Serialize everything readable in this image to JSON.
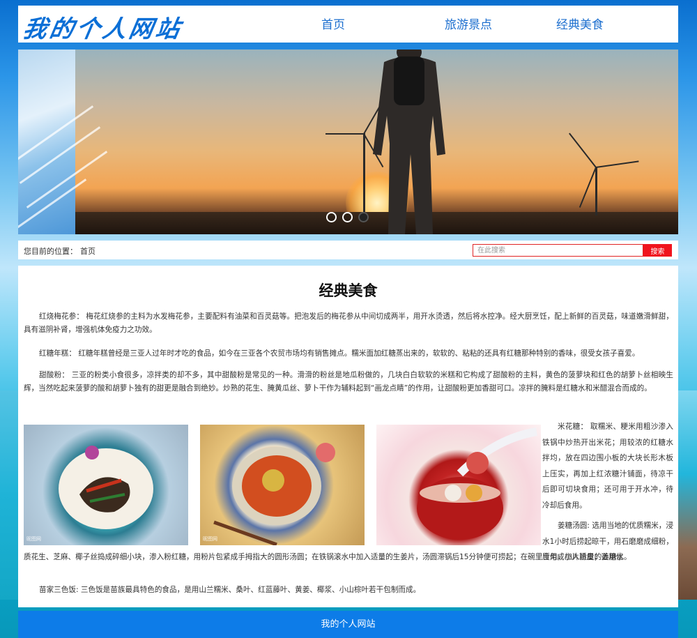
{
  "header": {
    "logo": "我的个人网站",
    "nav": [
      {
        "label": "首页"
      },
      {
        "label": "旅游景点"
      },
      {
        "label": "经典美食"
      }
    ]
  },
  "banner": {
    "slides": 3,
    "active_slide": 3
  },
  "location": {
    "label": "您目前的位置：",
    "value": "首页"
  },
  "search": {
    "placeholder": "在此搜索",
    "button": "搜索"
  },
  "content": {
    "title": "经典美食",
    "paragraphs": [
      "红烧梅花参： 梅花红烧参的主料为水发梅花参，主要配料有油菜和百灵菇等。把泡发后的梅花参从中间切成两半，用开水烫透，然后将水控净。经大厨烹饪，配上新鲜的百灵菇，味道嫩滑鲜甜，具有滋阴补肾，增强机体免疫力之功效。",
      "红糖年糕： 红糖年糕曾经是三亚人过年时才吃的食品，如今在三亚各个农贸市场均有销售摊点。糯米面加红糖蒸出来的，软软的、粘粘的还具有红糖那种特别的香味，很受女孩子喜爱。",
      "甜酸粉： 三亚的粉类小食很多，凉拌类的却不多，其中甜酸粉是常见的一种。滑滑的粉丝是地瓜粉做的，几块白白软软的米糕和它构成了甜酸粉的主料，黄色的菠萝块和红色的胡萝卜丝相映生辉，当然吃起来菠萝的酸和胡萝卜独有的甜更是融合到绝妙。炒熟的花生、腌黄瓜丝、萝卜干作为辅料起到“画龙点睛”的作用，让甜酸粉更加香甜可口。凉拌的腌料是红糖水和米醋混合而成的。"
    ],
    "images": [
      {
        "alt": "food-dish-1",
        "stamp": "昵图网"
      },
      {
        "alt": "food-dish-2",
        "stamp": "昵图网"
      },
      {
        "alt": "food-dish-3",
        "stamp": ""
      }
    ],
    "side_1": "米花糖： 取糯米、粳米用粗沙渗入铁锅中炒热开出米花；用较浓的红糖水拌均，放在四边围小板的大块长形木板上压实，再加上红浓糖汁铺面，待凉干后即可切块食用；还可用于开水冲，待冷却后食用。",
    "side_2": "姜糖汤圆: 选用当地的优质糯米，浸水1小时后捞起晾干，用石磨磨成细粉，压匀成小片粉皮；选用优",
    "wide_cont": "质花生、芝麻、椰子丝捣成碎细小块，渗入粉红糖，用粉片包紧成手拇指大的圆形汤圆；在铁锅滚水中加入适量的生姜片，汤圆滞锅后15分钟便可捞起；在碗里食用，加入适量的姜糖水。",
    "last": "苗家三色饭: 三色饭是苗族最具特色的食品，是用山兰糯米、桑叶、红蓝藤叶、黄姜、椰浆、小山棕叶若干包制而成。"
  },
  "footer": {
    "text": "我的个人网站"
  },
  "colors": {
    "brand_blue": "#0d7ce8",
    "nav_text": "#1d6fcf",
    "search_red": "#f0141e"
  }
}
